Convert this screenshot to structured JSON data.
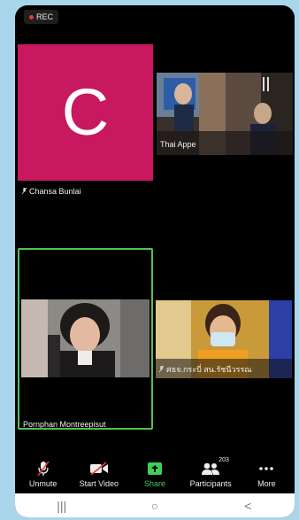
{
  "recording": {
    "label": "REC",
    "dot_color": "#e53935"
  },
  "participants_grid": {
    "tile_chansa": {
      "initial": "C",
      "name": "Chansa Bunlai",
      "avatar_color": "#c8185f"
    },
    "tile_thai": {
      "name": "Thai Appe"
    },
    "tile_pornphan": {
      "name": "Pornphan Montreepisut",
      "active_speaker_color": "#53c24f"
    },
    "tile_thai_office": {
      "name": "ศธจ.กระบี่ สน.รัชนีวรรณ"
    }
  },
  "toolbar": {
    "unmute": {
      "label": "Unmute",
      "icon": "muted-mic-icon"
    },
    "start_video": {
      "label": "Start Video",
      "icon": "video-off-icon"
    },
    "share": {
      "label": "Share",
      "icon": "share-icon",
      "color": "#3ecf5a"
    },
    "participants": {
      "label": "Participants",
      "count": "203",
      "icon": "participants-icon"
    },
    "more": {
      "label": "More",
      "icon": "more-icon"
    }
  },
  "system_nav": {
    "recents": "|||",
    "home": "○",
    "back": "<"
  }
}
